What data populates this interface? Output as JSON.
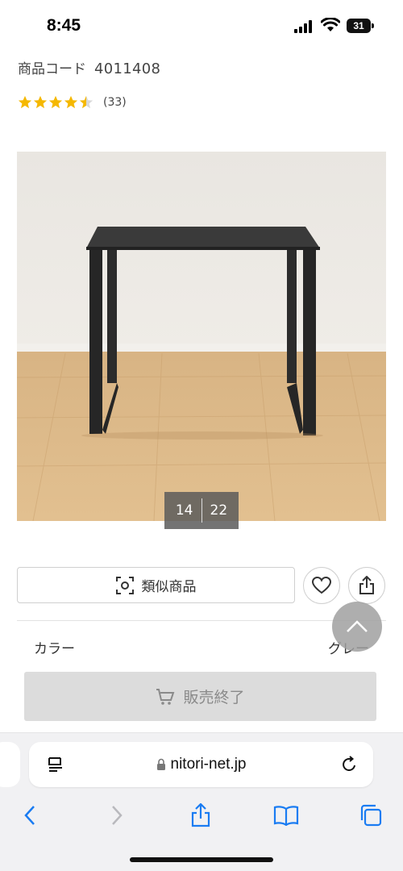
{
  "status_bar": {
    "time": "8:45",
    "battery": "31",
    "icons": [
      "signal-icon",
      "wifi-icon",
      "battery-icon"
    ]
  },
  "product": {
    "code_label": "商品コード",
    "code_value": "4011408",
    "rating": 4.5,
    "review_count": "(33)",
    "image_counter": {
      "current": "14",
      "total": "22"
    },
    "similar_label": "類似商品",
    "color_label": "カラー",
    "color_value": "グレー",
    "soldout_label": "販売終了"
  },
  "browser": {
    "url": "nitori-net.jp",
    "toolbar": [
      "back-icon",
      "forward-icon",
      "share-icon",
      "bookmarks-icon",
      "tabs-icon"
    ]
  },
  "colors": {
    "star": "#f5b800",
    "accent_blue": "#1a7cf2",
    "soldout_bg": "#dcdcdc"
  }
}
